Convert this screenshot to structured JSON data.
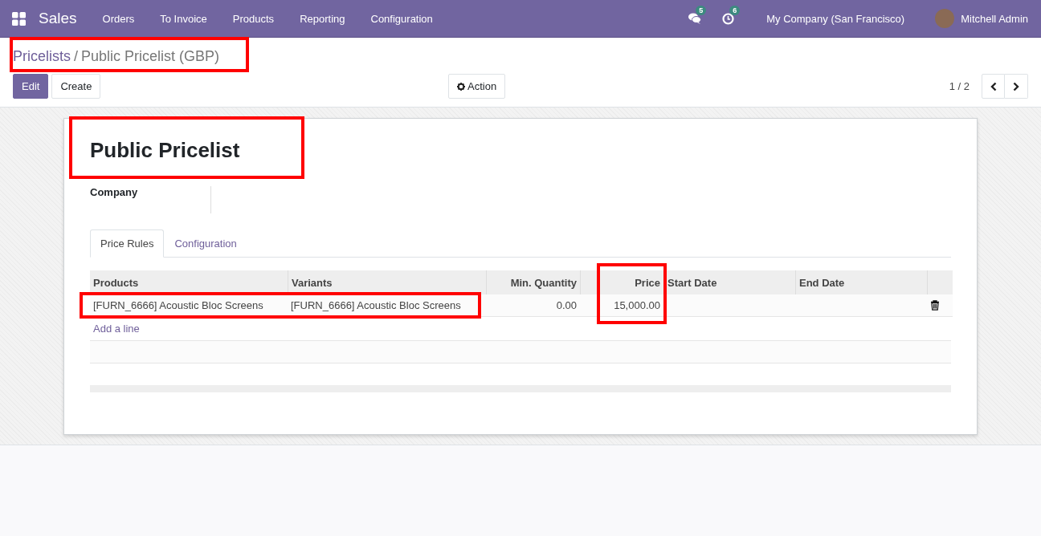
{
  "navbar": {
    "app": "Sales",
    "menu": [
      "Orders",
      "To Invoice",
      "Products",
      "Reporting",
      "Configuration"
    ],
    "messages_count": "5",
    "activities_count": "6",
    "company": "My Company (San Francisco)",
    "user": "Mitchell Admin"
  },
  "breadcrumb": {
    "parent": "Pricelists",
    "separator": "/",
    "current": "Public Pricelist (GBP)",
    "highlighted": true
  },
  "buttons": {
    "edit": "Edit",
    "create": "Create",
    "action": "Action"
  },
  "pager": "1 / 2",
  "form": {
    "title": "Public Pricelist",
    "title_highlighted": true,
    "company_label": "Company"
  },
  "tabs": [
    {
      "label": "Price Rules",
      "selected": true
    },
    {
      "label": "Configuration",
      "selected": false
    }
  ],
  "table": {
    "columns": [
      "Products",
      "Variants",
      "Min. Quantity",
      "Price",
      "Start Date",
      "End Date"
    ],
    "rows": [
      {
        "product": "[FURN_6666] Acoustic Bloc Screens",
        "variant": "[FURN_6666] Acoustic Bloc Screens",
        "min_quantity": "0.00",
        "price": "15,000.00",
        "highlighted": true
      }
    ],
    "price_column_highlighted": true,
    "add_line": "Add a line"
  }
}
